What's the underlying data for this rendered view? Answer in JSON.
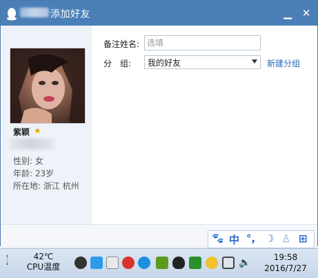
{
  "window": {
    "title": "添加好友",
    "min_label": "▁",
    "close_label": "✕"
  },
  "profile": {
    "nickname": "紫颖",
    "star": "★",
    "gender": "性别: 女",
    "age": "年龄: 23岁",
    "location": "所在地: 浙江  杭州"
  },
  "form": {
    "remark_label": "备注姓名:",
    "remark_placeholder": "选填",
    "group_label": "分　组:",
    "group_value": "我的好友",
    "new_group_label": "新建分组"
  },
  "ime": {
    "paw": "🐾",
    "lang": "中",
    "punct": "°,",
    "moon": "☽",
    "user": "♙",
    "grid": "⊞"
  },
  "taskbar": {
    "temp": "42℃",
    "temp_label": "CPU温度",
    "time": "19:58",
    "date": "2016/7/27",
    "icons": [
      "cat-icon",
      "cube-icon",
      "weibo-icon",
      "netease-music-icon",
      "video-player-icon",
      "nvidia-icon",
      "qq-penguin-icon",
      "shield-icon",
      "game-icon",
      "monitor-icon",
      "volume-icon"
    ]
  }
}
